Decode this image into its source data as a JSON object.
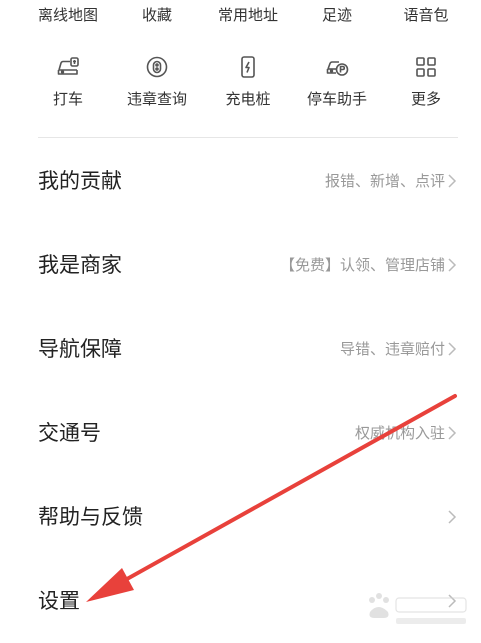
{
  "top_row": {
    "items": [
      "离线地图",
      "收藏",
      "常用地址",
      "足迹",
      "语音包"
    ]
  },
  "tools": [
    {
      "label": "打车",
      "icon": "taxi-car-icon"
    },
    {
      "label": "违章查询",
      "icon": "violation-query-icon"
    },
    {
      "label": "充电桩",
      "icon": "charging-pile-icon"
    },
    {
      "label": "停车助手",
      "icon": "parking-assistant-icon"
    },
    {
      "label": "更多",
      "icon": "grid-more-icon"
    }
  ],
  "menu": [
    {
      "title": "我的贡献",
      "subtitle": "报错、新增、点评"
    },
    {
      "title": "我是商家",
      "subtitle": "【免费】认领、管理店铺"
    },
    {
      "title": "导航保障",
      "subtitle": "导错、违章赔付"
    },
    {
      "title": "交通号",
      "subtitle": "权威机构入驻"
    },
    {
      "title": "帮助与反馈",
      "subtitle": ""
    },
    {
      "title": "设置",
      "subtitle": ""
    }
  ],
  "colors": {
    "text_primary": "#222222",
    "text_secondary": "#999999",
    "icon_stroke": "#555555",
    "divider": "#e6e6e6",
    "annotation_arrow": "#e8413b"
  }
}
